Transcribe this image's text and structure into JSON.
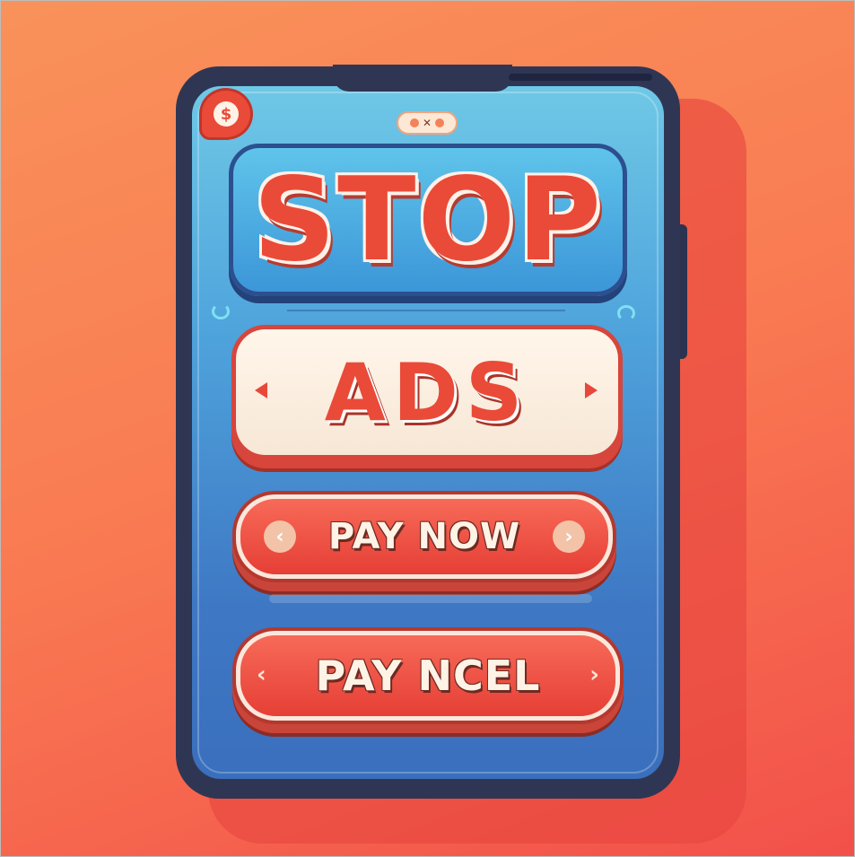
{
  "stop_title": "STOP",
  "ads_title": "ADS",
  "coin_symbol": "$",
  "buttons": {
    "pay_now": "PAY NOW",
    "pay_ncel": "PAY NCEL"
  },
  "icons": {
    "coin": "dollar-coin-icon",
    "chevron_left": "‹",
    "chevron_right": "›"
  },
  "colors": {
    "background": "#f97a52",
    "accent_red": "#ea4a38",
    "screen_blue": "#4fa4dc",
    "phone_body": "#2f3654"
  }
}
